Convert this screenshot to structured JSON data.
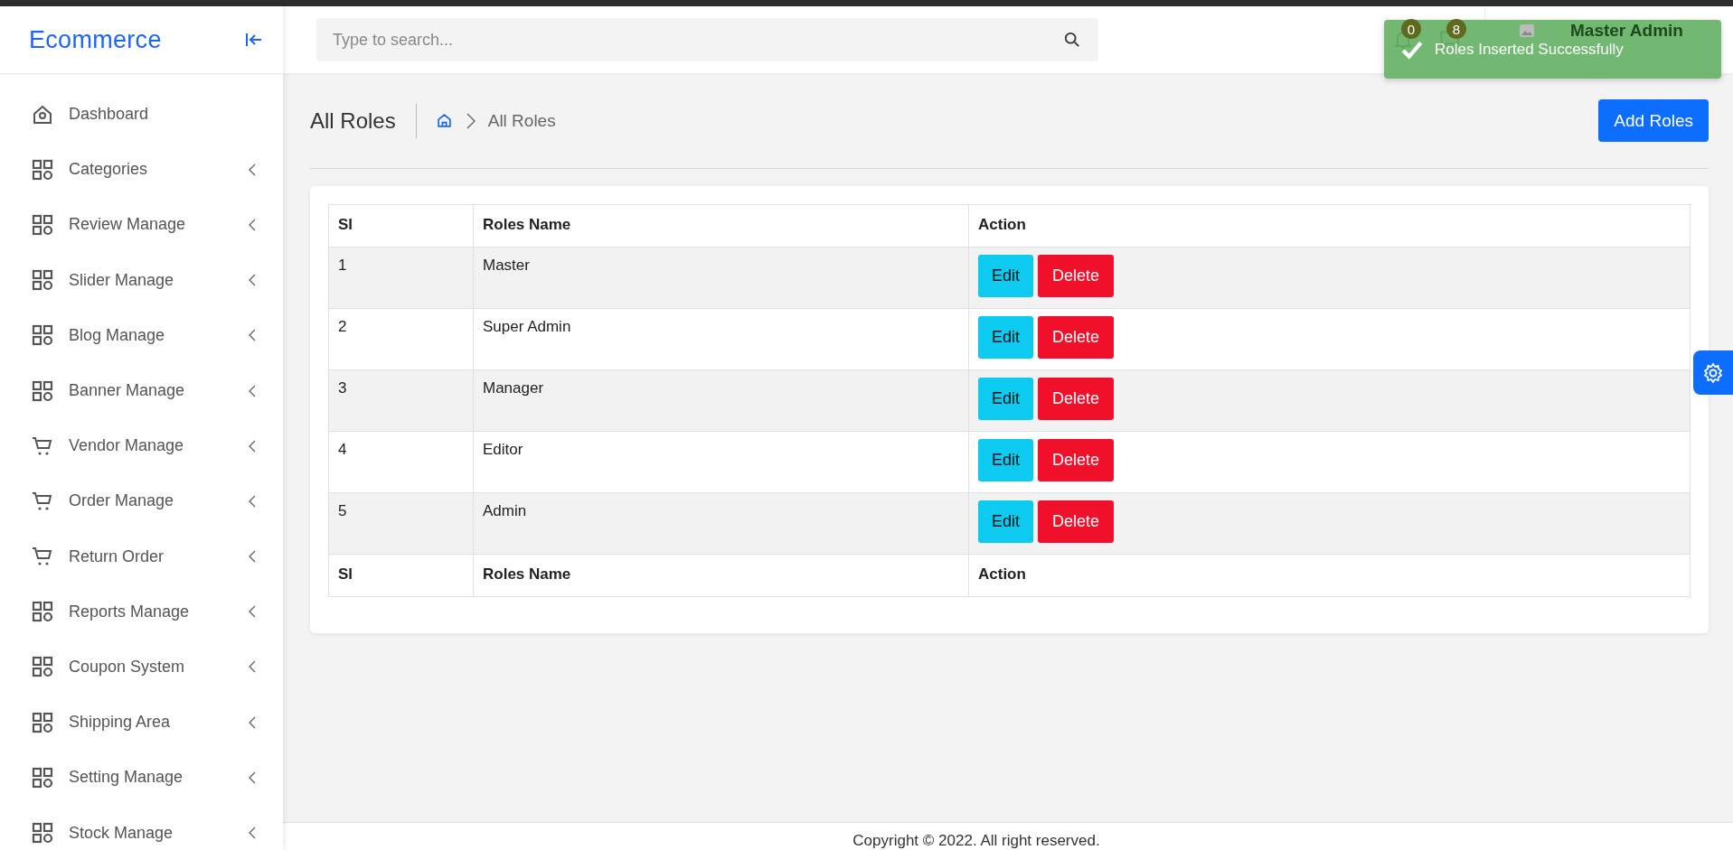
{
  "sidebar": {
    "logo": "Ecommerce",
    "items": [
      {
        "label": "Dashboard",
        "kind": "home",
        "expandable": false
      },
      {
        "label": "Categories",
        "kind": "grid",
        "expandable": true
      },
      {
        "label": "Review Manage",
        "kind": "grid",
        "expandable": true
      },
      {
        "label": "Slider Manage",
        "kind": "grid",
        "expandable": true
      },
      {
        "label": "Blog Manage",
        "kind": "grid",
        "expandable": true
      },
      {
        "label": "Banner Manage",
        "kind": "grid",
        "expandable": true
      },
      {
        "label": "Vendor Manage",
        "kind": "cart",
        "expandable": true
      },
      {
        "label": "Order Manage",
        "kind": "cart",
        "expandable": true
      },
      {
        "label": "Return Order",
        "kind": "cart",
        "expandable": true
      },
      {
        "label": "Reports Manage",
        "kind": "grid",
        "expandable": true
      },
      {
        "label": "Coupon System",
        "kind": "grid",
        "expandable": true
      },
      {
        "label": "Shipping Area",
        "kind": "grid",
        "expandable": true
      },
      {
        "label": "Setting Manage",
        "kind": "grid",
        "expandable": true
      },
      {
        "label": "Stock Manage",
        "kind": "grid",
        "expandable": true
      }
    ]
  },
  "header": {
    "search": {
      "placeholder": "Type to search..."
    },
    "notifications_badge": "0",
    "messages_badge": "8",
    "user_name": "Master Admin"
  },
  "toast": {
    "message": "Roles Inserted Successfully"
  },
  "page": {
    "title": "All Roles",
    "breadcrumb": "All Roles",
    "add_button": "Add Roles"
  },
  "table": {
    "columns": [
      "Sl",
      "Roles Name",
      "Action"
    ],
    "rows": [
      {
        "sl": "1",
        "name": "Master",
        "actions": [
          "Edit",
          "Delete"
        ]
      },
      {
        "sl": "2",
        "name": "Super Admin",
        "actions": [
          "Edit",
          "Delete"
        ]
      },
      {
        "sl": "3",
        "name": "Manager",
        "actions": [
          "Edit",
          "Delete"
        ]
      },
      {
        "sl": "4",
        "name": "Editor",
        "actions": [
          "Edit",
          "Delete"
        ]
      },
      {
        "sl": "5",
        "name": "Admin",
        "actions": [
          "Edit",
          "Delete"
        ]
      }
    ],
    "footer_columns": [
      "Sl",
      "Roles Name",
      "Action"
    ]
  },
  "footer": "Copyright © 2022. All right reserved."
}
